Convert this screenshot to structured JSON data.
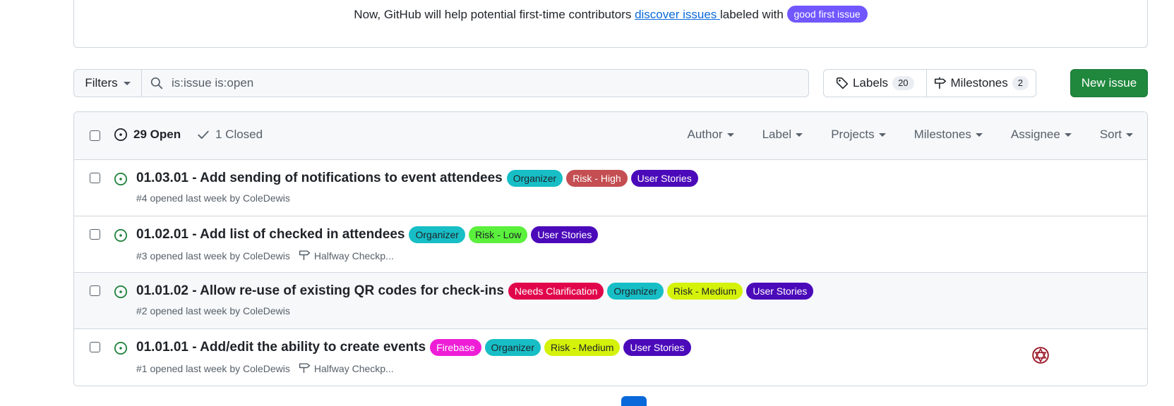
{
  "banner": {
    "text_before": "Now, GitHub will help potential first-time contributors ",
    "link": "discover issues ",
    "text_after": " labeled with ",
    "label": "good first issue"
  },
  "toolbar": {
    "filters_label": "Filters",
    "search_value": "is:issue is:open",
    "labels_label": "Labels",
    "labels_count": "20",
    "milestones_label": "Milestones",
    "milestones_count": "2",
    "new_issue_label": "New issue"
  },
  "header": {
    "open_label": "29 Open",
    "closed_label": "1 Closed",
    "filters": [
      "Author",
      "Label",
      "Projects",
      "Milestones",
      "Assignee",
      "Sort"
    ]
  },
  "colors": {
    "accent_green": "#1f883d",
    "open_icon": "#1a7f37",
    "link": "#0969da"
  },
  "issues": [
    {
      "title": "01.03.01 - Add sending of notifications to event attendees",
      "meta": "#4 opened last week by ColeDewis",
      "milestone": "",
      "labels": [
        {
          "text": "Organizer",
          "bg": "#17bec6",
          "fg": "#1f2328"
        },
        {
          "text": "Risk - High",
          "bg": "#c44e52",
          "fg": "#ffffff"
        },
        {
          "text": "User Stories",
          "bg": "#4b0ab9",
          "fg": "#ffffff"
        }
      ]
    },
    {
      "title": "01.02.01 - Add list of checked in attendees",
      "meta": "#3 opened last week by ColeDewis",
      "milestone": "Halfway Checkp...",
      "labels": [
        {
          "text": "Organizer",
          "bg": "#17bec6",
          "fg": "#1f2328"
        },
        {
          "text": "Risk - Low",
          "bg": "#5af03c",
          "fg": "#1f2328"
        },
        {
          "text": "User Stories",
          "bg": "#4b0ab9",
          "fg": "#ffffff"
        }
      ]
    },
    {
      "title": "01.01.02 - Allow re-use of existing QR codes for check-ins",
      "meta": "#2 opened last week by ColeDewis",
      "milestone": "",
      "labels": [
        {
          "text": "Needs Clarification",
          "bg": "#e1064b",
          "fg": "#ffffff"
        },
        {
          "text": "Organizer",
          "bg": "#17bec6",
          "fg": "#1f2328"
        },
        {
          "text": "Risk - Medium",
          "bg": "#d4f20a",
          "fg": "#1f2328"
        },
        {
          "text": "User Stories",
          "bg": "#4b0ab9",
          "fg": "#ffffff"
        }
      ]
    },
    {
      "title": "01.01.01 - Add/edit the ability to create events",
      "meta": "#1 opened last week by ColeDewis",
      "milestone": "Halfway Checkp...",
      "labels": [
        {
          "text": "Firebase",
          "bg": "#ee1ed7",
          "fg": "#ffffff"
        },
        {
          "text": "Organizer",
          "bg": "#17bec6",
          "fg": "#1f2328"
        },
        {
          "text": "Risk - Medium",
          "bg": "#d4f20a",
          "fg": "#1f2328"
        },
        {
          "text": "User Stories",
          "bg": "#4b0ab9",
          "fg": "#ffffff"
        }
      ]
    }
  ]
}
